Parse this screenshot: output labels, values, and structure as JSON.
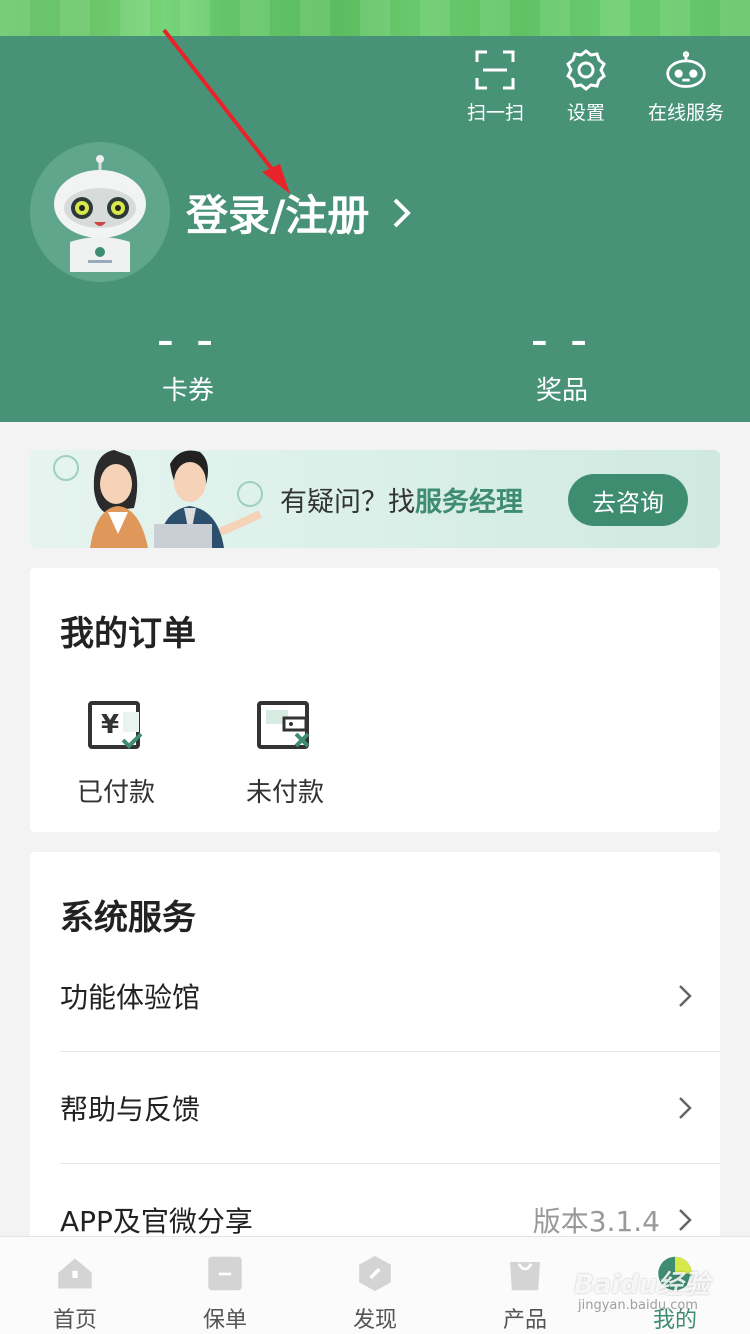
{
  "header": {
    "actions": [
      {
        "label": "扫一扫",
        "icon": "scan-icon"
      },
      {
        "label": "设置",
        "icon": "gear-icon"
      },
      {
        "label": "在线服务",
        "icon": "robot-service-icon"
      }
    ],
    "login_label": "登录/注册",
    "stats": [
      {
        "value": "– –",
        "name": "卡券"
      },
      {
        "value": "– –",
        "name": "奖品"
      }
    ],
    "bg_color": "#489378"
  },
  "banner": {
    "text_prefix": "有疑问？找",
    "text_highlight": "服务经理",
    "button_label": "去咨询"
  },
  "orders": {
    "title": "我的订单",
    "items": [
      {
        "label": "已付款",
        "icon": "yuan-check-icon"
      },
      {
        "label": "未付款",
        "icon": "wallet-x-icon"
      }
    ]
  },
  "services": {
    "title": "系统服务",
    "rows": [
      {
        "label": "功能体验馆",
        "sub": ""
      },
      {
        "label": "帮助与反馈",
        "sub": ""
      },
      {
        "label": "APP及官微分享",
        "sub": "版本3.1.4"
      }
    ]
  },
  "tabbar": {
    "tabs": [
      {
        "label": "首页",
        "icon": "home-icon"
      },
      {
        "label": "保单",
        "icon": "policy-icon"
      },
      {
        "label": "发现",
        "icon": "discover-icon"
      },
      {
        "label": "产品",
        "icon": "bag-icon"
      },
      {
        "label": "我的",
        "icon": "profile-icon"
      }
    ],
    "active_index": 4
  },
  "watermark": {
    "text": "Baidu经验",
    "sub": "jingyan.baidu.com"
  },
  "colors": {
    "accent": "#3f8d70",
    "header": "#489378",
    "arrow": "#e8242a"
  }
}
